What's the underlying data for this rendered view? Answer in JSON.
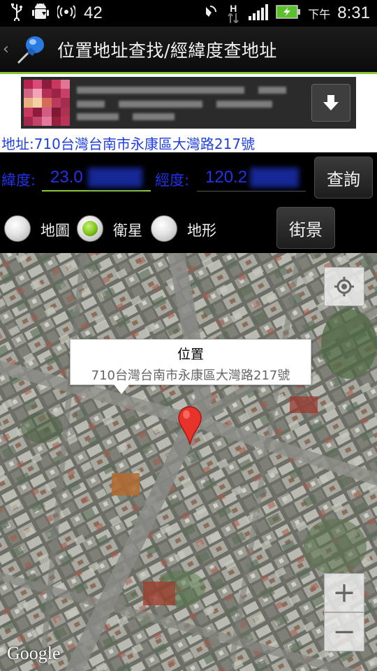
{
  "status_bar": {
    "notification_count": "42",
    "am_pm": "下午",
    "time": "8:31",
    "network_type": "H",
    "icons": [
      "usb-icon",
      "android-debug-icon",
      "wifi-hotspot-icon",
      "mute-icon",
      "network-h-icon",
      "signal-icon",
      "battery-charging-icon"
    ]
  },
  "title_bar": {
    "title": "位置地址查找/經緯度查地址",
    "icon": "pushpin-icon"
  },
  "ad": {
    "download_icon": "download-arrow-icon"
  },
  "address": {
    "text": "地址:710台灣台南市永康區大灣路217號"
  },
  "coordinates": {
    "latitude_label": "緯度:",
    "latitude_value": "23.0",
    "longitude_label": "經度:",
    "longitude_value": "120.2",
    "query_button": "查詢"
  },
  "map_type": {
    "options": [
      {
        "label": "地圖",
        "checked": false
      },
      {
        "label": "衛星",
        "checked": true
      },
      {
        "label": "地形",
        "checked": false
      }
    ],
    "street_view_button": "街景"
  },
  "map": {
    "info_window_title": "位置",
    "info_window_snippet": "710台灣台南市永康區大灣路217號",
    "zoom_in": "+",
    "zoom_out": "−",
    "google_logo": "Google",
    "marker_color": "#e8332b",
    "my_location_icon": "crosshair-icon"
  }
}
